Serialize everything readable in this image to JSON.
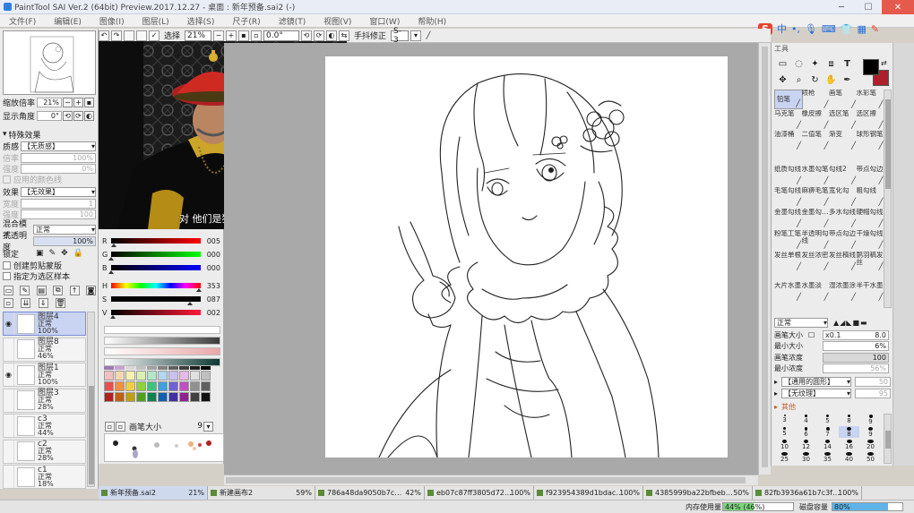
{
  "window": {
    "title": "PaintTool SAI Ver.2 (64bit) Preview.2017.12.27 - 桌面 : 新年预备.sai2 (-)"
  },
  "menu": [
    "文件(F)",
    "编辑(E)",
    "图像(I)",
    "图层(L)",
    "选择(S)",
    "尺子(R)",
    "滤镜(T)",
    "视图(V)",
    "窗口(W)",
    "帮助(H)"
  ],
  "ime": {
    "logo": "S",
    "lang": "中"
  },
  "toolbar": {
    "select_label": "选择",
    "zoom": "21%",
    "angle": "0.0°",
    "stabilizer_label": "手抖修正",
    "stabilizer_value": "S-3"
  },
  "nav": {
    "zoom_label": "缩放倍率",
    "zoom_value": "21%",
    "angle_label": "显示角度",
    "angle_value": "0°"
  },
  "effects": {
    "header": "特殊效果",
    "texture_label": "质感",
    "texture_value": "【无质感】",
    "scale_label": "倍率",
    "scale_value": "100%",
    "strength_label": "强度",
    "strength_value": "0%",
    "applied_label": "应用的颜色线",
    "effect_label": "效果",
    "effect_value": "【无效果】",
    "width_label": "宽度",
    "width_value": "1",
    "effect_strength_label": "强度",
    "effect_strength_value": "100"
  },
  "layer_props": {
    "blend_label": "混合模式",
    "blend_value": "正常",
    "opacity_label": "不透明度",
    "opacity_value": "100%",
    "lock_label": "锁定",
    "clip_label": "创建剪贴蒙版",
    "selsrc_label": "指定为选区样本"
  },
  "layers": [
    {
      "name": "图层4",
      "mode": "正常",
      "opacity": "100%",
      "visible": true,
      "selected": true
    },
    {
      "name": "图层8",
      "mode": "正常",
      "opacity": "46%",
      "visible": false,
      "selected": false
    },
    {
      "name": "图层1",
      "mode": "正常",
      "opacity": "100%",
      "visible": true,
      "selected": false
    },
    {
      "name": "图层3",
      "mode": "正常",
      "opacity": "28%",
      "visible": false,
      "selected": false
    },
    {
      "name": "c3",
      "mode": "正常",
      "opacity": "44%",
      "visible": false,
      "selected": false
    },
    {
      "name": "c2",
      "mode": "正常",
      "opacity": "28%",
      "visible": false,
      "selected": false
    },
    {
      "name": "c1",
      "mode": "正常",
      "opacity": "18%",
      "visible": false,
      "selected": false
    }
  ],
  "video": {
    "subtitle": "对 他们是猪 是狗"
  },
  "color": {
    "R": {
      "label": "R",
      "value": "005"
    },
    "G": {
      "label": "G",
      "value": "000"
    },
    "B": {
      "label": "B",
      "value": "000"
    },
    "H": {
      "label": "H",
      "value": "353"
    },
    "S": {
      "label": "S",
      "value": "087"
    },
    "V": {
      "label": "V",
      "value": "002"
    },
    "swatches": [
      "#ffffff",
      "#3b3b3b",
      "#f0c8c8",
      "#1a3a3a"
    ],
    "brush_size_label": "画笔大小",
    "brush_size_value": "9"
  },
  "tools": {
    "header": "工具",
    "primary_color": "#000000",
    "secondary_color": "#b0202b"
  },
  "brushes": [
    [
      "铅笔",
      "喷枪",
      "画笔",
      "水彩笔"
    ],
    [
      "马克笔",
      "橡皮擦",
      "选区笔",
      "选区擦"
    ],
    [
      "油漆桶",
      "二值笔",
      "渐变",
      "球形钢笔"
    ],
    [
      "纸质勾线",
      "水墨勾笔",
      "勾线2",
      "带点勾边"
    ],
    [
      "毛笔勾线",
      "麻痹毛笔",
      "宽化勾",
      "粗勾线"
    ],
    [
      "金墨勾线",
      "金墨勾…",
      "多水勾线",
      "硬帽勾线"
    ],
    [
      "粉笔工笔",
      "半透明勾线",
      "带点勾边",
      "干燥勾线"
    ],
    [
      "发丝单根",
      "发丝浓密",
      "发丝稿线",
      "鹅羽稿发丝"
    ],
    [
      "大片水墨",
      "水墨淡",
      "湿浓墨涂",
      "半干水墨"
    ]
  ],
  "brush_props": {
    "mode_value": "正常",
    "size_label": "画笔大小",
    "size_mult": "x0.1",
    "size_value": "8.0",
    "min_label": "最小大小",
    "min_value": "6%",
    "density_label": "画笔浓度",
    "density_value": "100",
    "min_density_label": "最小浓度",
    "min_density_value": "56%",
    "shape_value": "【通用的圆形】",
    "shape_num": "50",
    "texture_value": "【无纹理】",
    "texture_num": "95",
    "other_label": "其他",
    "sizes": [
      "3",
      "4",
      "5",
      "8",
      "9",
      "5",
      "6",
      "7",
      "8",
      "9",
      "10",
      "12",
      "14",
      "16",
      "20",
      "25",
      "30",
      "35",
      "40",
      "50"
    ]
  },
  "tabs": [
    {
      "name": "新年预备.sai2",
      "pct": "21%",
      "active": true
    },
    {
      "name": "新建画布2",
      "pct": "59%",
      "active": false
    },
    {
      "name": "786a48da9050b7c…",
      "pct": "42%",
      "active": false
    },
    {
      "name": "eb07c87ff3805d72…",
      "pct": "100%",
      "active": false
    },
    {
      "name": "f923954389d1bdac…",
      "pct": "100%",
      "active": false
    },
    {
      "name": "4385999ba22bfbeb…",
      "pct": "50%",
      "active": false
    },
    {
      "name": "82fb3936a61b7c3f…",
      "pct": "100%",
      "active": false
    }
  ],
  "status": {
    "mem_label": "内存使用量",
    "mem_value": "44% (46%)",
    "mem_fraction": 0.44,
    "disk_label": "磁盘容量",
    "disk_value": "80%",
    "disk_fraction": 0.8
  }
}
